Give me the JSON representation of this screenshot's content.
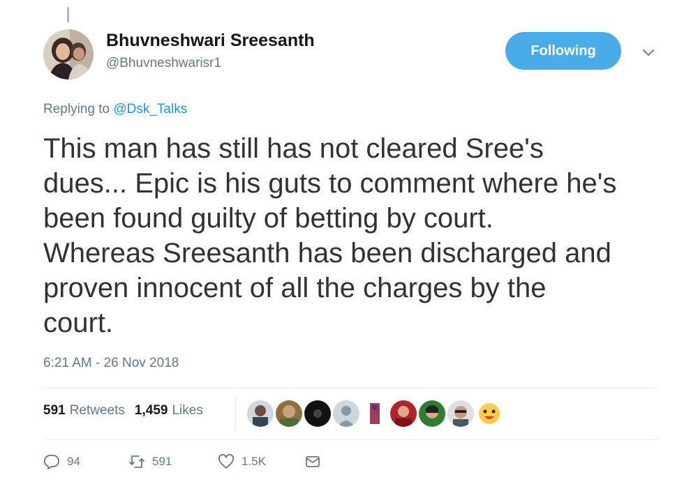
{
  "user": {
    "display_name": "Bhuvneshwari Sreesanth",
    "handle": "@Bhuvneshwarisr1"
  },
  "follow_button": {
    "label": "Following",
    "color": "#4aabe9"
  },
  "reply_context": {
    "prefix": "Replying to",
    "mention": "@Dsk_Talks"
  },
  "tweet": {
    "lines": [
      "This man has still has not cleared Sree's",
      "dues... Epic is his guts to comment where he's",
      "been found guilty of betting by court.",
      "Whereas Sreesanth has been discharged and",
      "proven innocent of all the charges by the",
      "court."
    ],
    "timestamp": "6:21 AM - 26 Nov 2018"
  },
  "stats": {
    "retweets_count": "591",
    "retweets_label": "Retweets",
    "likes_count": "1,459",
    "likes_label": "Likes"
  },
  "actions": {
    "reply_count": "94",
    "retweet_count": "591",
    "like_count": "1.5K"
  },
  "icons": {
    "caret": "chevron-down-icon",
    "reply": "reply-icon",
    "retweet": "retweet-icon",
    "like": "heart-icon",
    "message": "envelope-icon"
  },
  "colors": {
    "link": "#1b95e0",
    "secondary_text": "#657786",
    "tweet_text": "#2f3336"
  }
}
